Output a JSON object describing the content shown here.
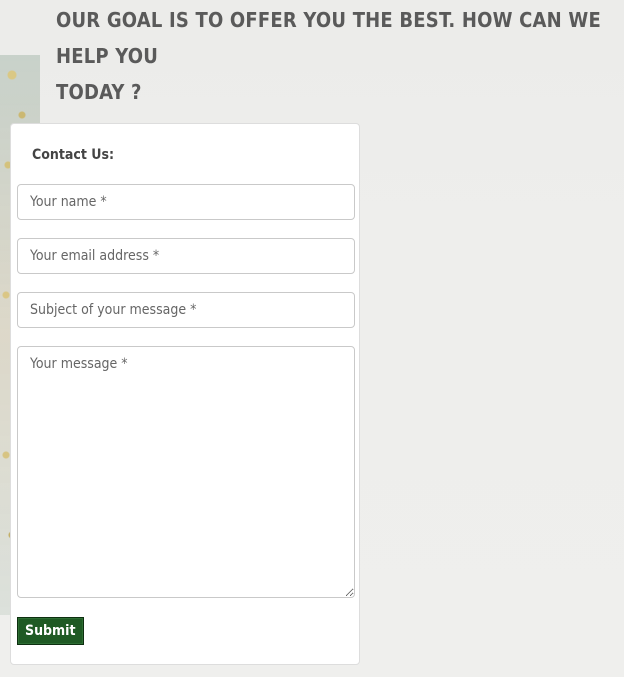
{
  "heading": {
    "line1": "OUR GOAL IS TO OFFER YOU THE BEST. HOW CAN WE HELP YOU",
    "line2": "TODAY ?"
  },
  "contact_form": {
    "title": "Contact Us:",
    "name_placeholder": "Your name *",
    "email_placeholder": "Your email address *",
    "subject_placeholder": "Subject of your message *",
    "message_placeholder": "Your message *",
    "submit_label": "Submit"
  },
  "colors": {
    "submit_background": "#1f5a24",
    "heading_text": "#5a5a5a",
    "page_background": "#ececea"
  }
}
